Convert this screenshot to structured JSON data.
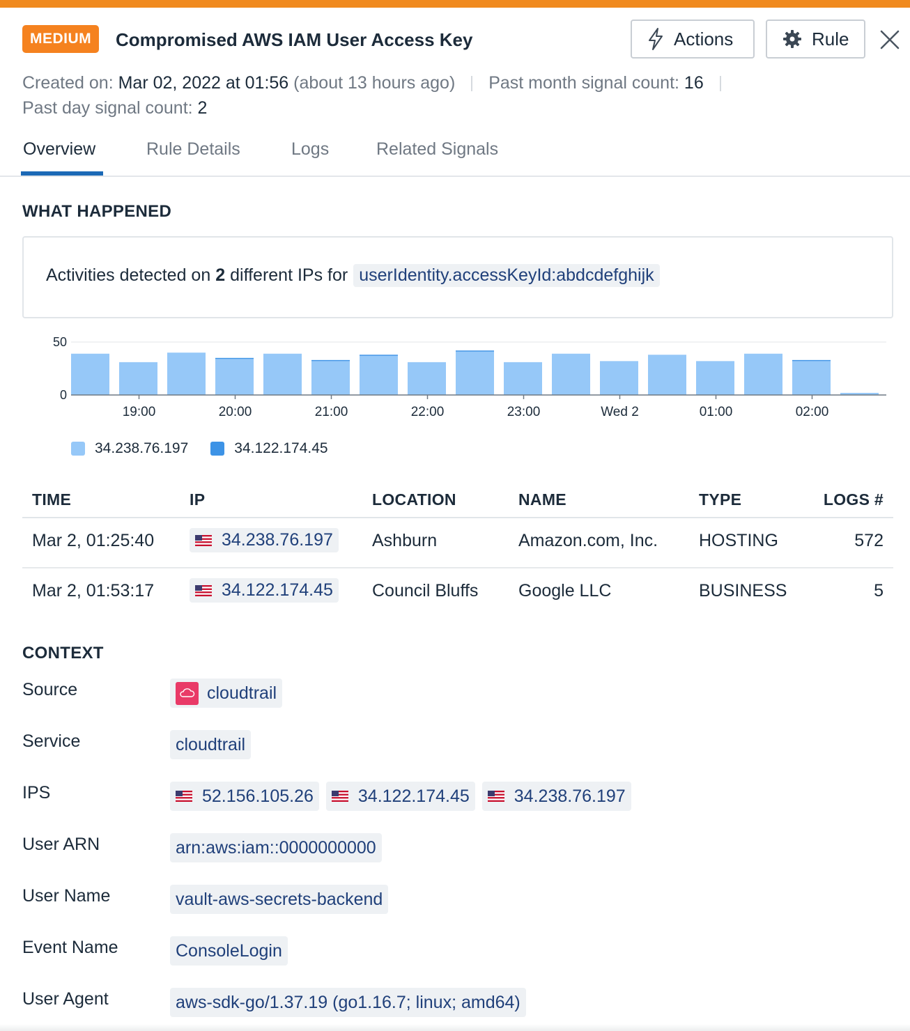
{
  "header": {
    "severity": "MEDIUM",
    "title": "Compromised AWS IAM User Access Key",
    "actions_label": "Actions",
    "rule_label": "Rule"
  },
  "meta": {
    "created_label": "Created on:",
    "created_value": "Mar 02, 2022 at 01:56",
    "created_relative": "(about 13 hours ago)",
    "month_label": "Past month signal count:",
    "month_value": "16",
    "day_label": "Past day signal count:",
    "day_value": "2"
  },
  "tabs": [
    {
      "label": "Overview",
      "active": true
    },
    {
      "label": "Rule Details",
      "active": false
    },
    {
      "label": "Logs",
      "active": false
    },
    {
      "label": "Related Signals",
      "active": false
    }
  ],
  "what_happened": {
    "title": "WHAT HAPPENED",
    "text_prefix": "Activities detected on",
    "count": "2",
    "text_mid": "different IPs for",
    "query": "userIdentity.accessKeyId:abdcdefghijk"
  },
  "chart_data": {
    "type": "bar",
    "stacked": true,
    "y_ticks": [
      "50",
      "0"
    ],
    "ylim": [
      0,
      50
    ],
    "x_tick_labels": [
      "19:00",
      "20:00",
      "21:00",
      "22:00",
      "23:00",
      "Wed 2",
      "01:00",
      "02:00"
    ],
    "series": [
      {
        "name": "34.238.76.197",
        "color": "#96c8f8",
        "values": [
          39,
          31,
          40,
          34,
          39,
          32,
          37,
          31,
          41,
          31,
          39,
          32,
          38,
          32,
          39,
          32,
          2
        ]
      },
      {
        "name": "34.122.174.45",
        "color": "#3d93e6",
        "values": [
          0,
          0,
          0,
          1,
          0,
          1,
          1,
          0,
          1,
          0,
          0,
          0,
          0,
          0,
          0,
          1,
          0
        ]
      }
    ],
    "legend_position": "bottom-left",
    "grid": true
  },
  "ip_table": {
    "headers": [
      "TIME",
      "IP",
      "LOCATION",
      "NAME",
      "TYPE",
      "LOGS #"
    ],
    "rows": [
      {
        "time": "Mar 2, 01:25:40",
        "ip": "34.238.76.197",
        "location": "Ashburn",
        "name": "Amazon.com, Inc.",
        "type": "HOSTING",
        "logs": "572"
      },
      {
        "time": "Mar 2, 01:53:17",
        "ip": "34.122.174.45",
        "location": "Council Bluffs",
        "name": "Google LLC",
        "type": "BUSINESS",
        "logs": "5"
      }
    ]
  },
  "context": {
    "title": "CONTEXT",
    "source_label": "Source",
    "source_value": "cloudtrail",
    "service_label": "Service",
    "service_value": "cloudtrail",
    "ips_label": "IPS",
    "ips": [
      "52.156.105.26",
      "34.122.174.45",
      "34.238.76.197"
    ],
    "user_arn_label": "User ARN",
    "user_arn_value": "arn:aws:iam::0000000000",
    "user_name_label": "User Name",
    "user_name_value": "vault-aws-secrets-backend",
    "event_name_label": "Event Name",
    "event_name_value": "ConsoleLogin",
    "user_agent_label": "User Agent",
    "user_agent_value": "aws-sdk-go/1.37.19 (go1.16.7; linux; amd64)"
  },
  "colors": {
    "accent_orange": "#f08a1f",
    "severity_orange": "#f5821f",
    "tab_active": "#1b69b6",
    "chip_text": "#20407a",
    "source_icon": "#e93a67"
  }
}
